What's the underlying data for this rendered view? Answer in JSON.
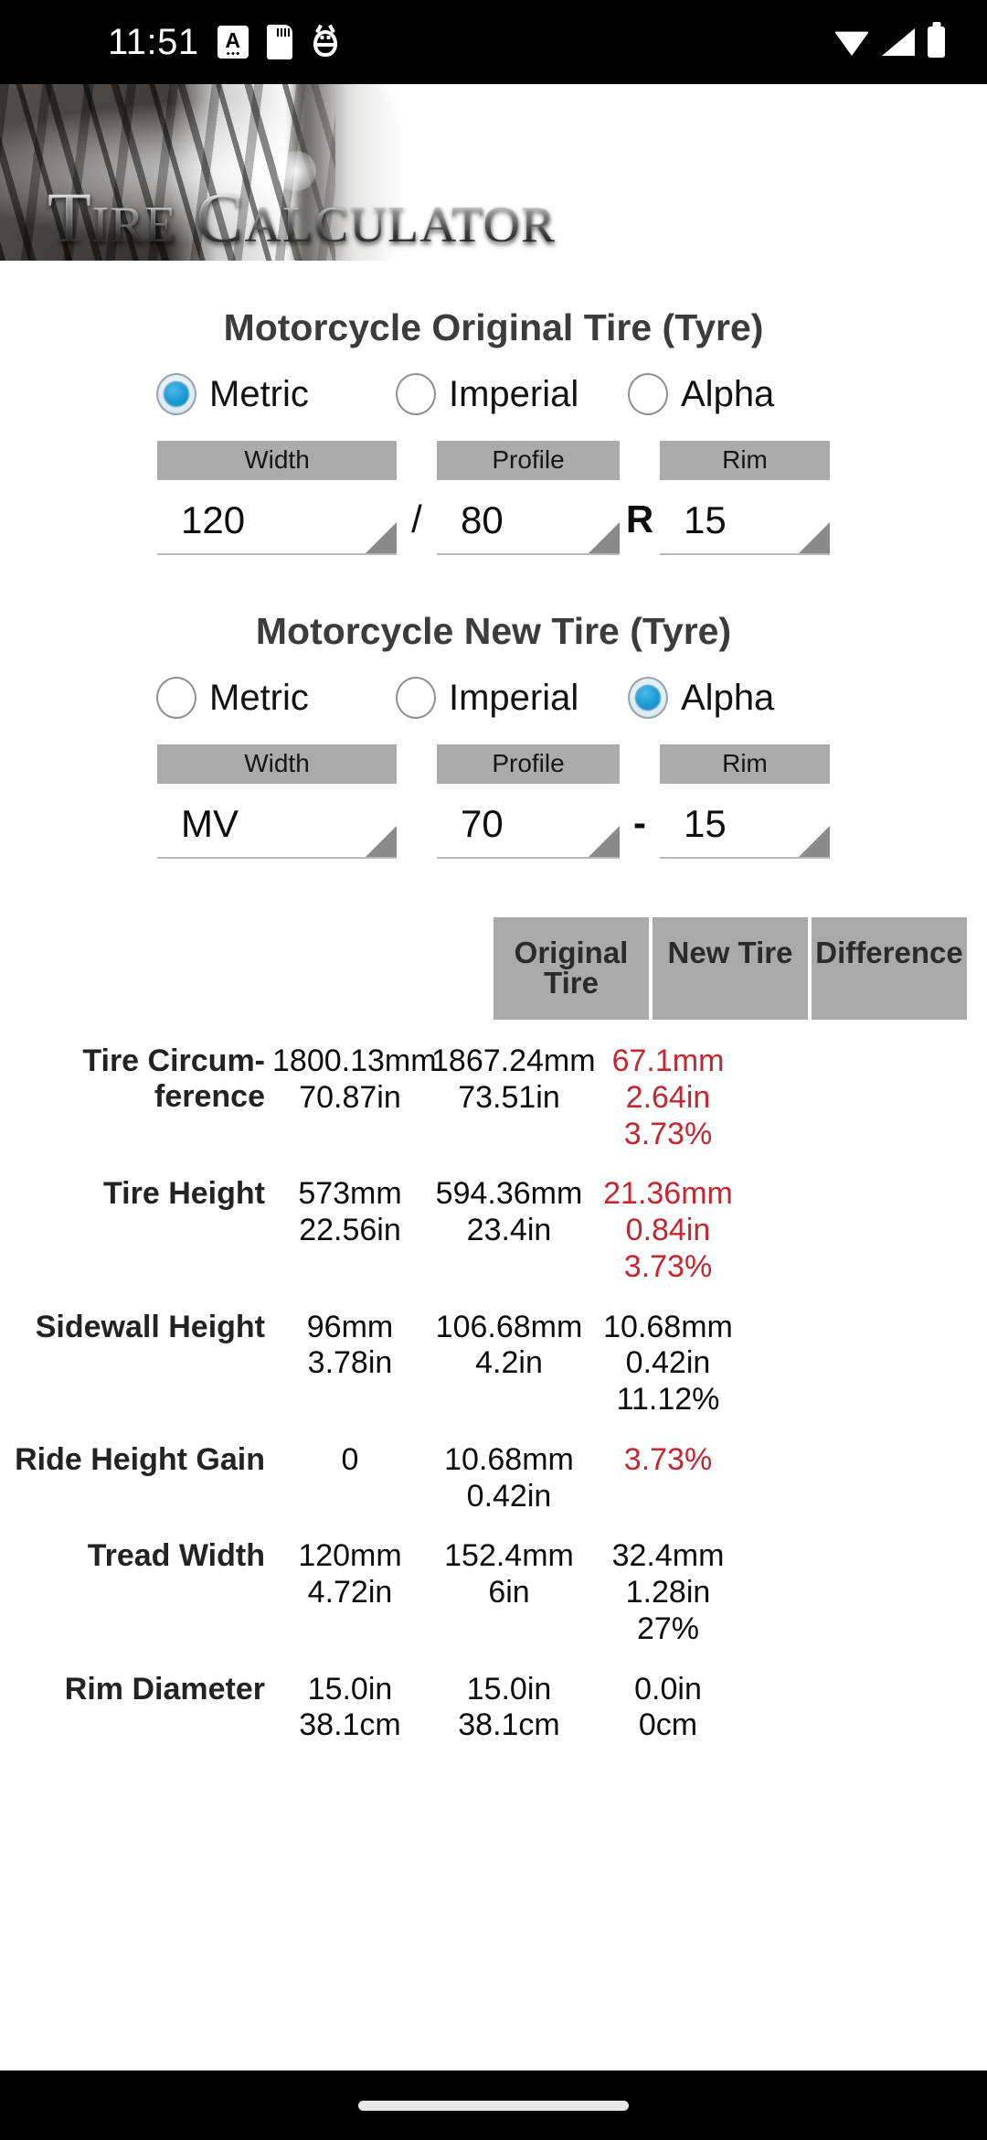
{
  "status_bar": {
    "time": "11:51",
    "icons_left": [
      "text-a-icon",
      "sdcard-icon",
      "bug-icon"
    ],
    "icons_right": [
      "wifi-icon",
      "cell-signal-icon",
      "battery-icon"
    ]
  },
  "banner": {
    "title_first": "T",
    "title_first_rest": "IRE",
    "title_second": "C",
    "title_second_rest": "ALCULATOR"
  },
  "original": {
    "heading": "Motorcycle Original Tire (Tyre)",
    "units": [
      {
        "label": "Metric",
        "selected": true
      },
      {
        "label": "Imperial",
        "selected": false
      },
      {
        "label": "Alpha",
        "selected": false
      }
    ],
    "fields": [
      {
        "head": "Width",
        "value": "120"
      },
      {
        "head": "Profile",
        "value": "80"
      },
      {
        "head": "Rim",
        "value": "15"
      }
    ],
    "sep1": "/",
    "sep2": "R"
  },
  "newtire": {
    "heading": "Motorcycle New Tire (Tyre)",
    "units": [
      {
        "label": "Metric",
        "selected": false
      },
      {
        "label": "Imperial",
        "selected": false
      },
      {
        "label": "Alpha",
        "selected": true
      }
    ],
    "fields": [
      {
        "head": "Width",
        "value": "MV"
      },
      {
        "head": "Profile",
        "value": "70"
      },
      {
        "head": "Rim",
        "value": "15"
      }
    ],
    "sep1": "",
    "sep2": "-"
  },
  "results": {
    "columns": [
      "Original Tire",
      "New Tire",
      "Difference"
    ],
    "accent_red": "#c32832",
    "rows": [
      {
        "label": "Tire Circum-ference",
        "original": [
          "1800.13mm",
          "70.87in"
        ],
        "new": [
          "1867.24mm",
          "73.51in"
        ],
        "difference": [
          "67.1mm",
          "2.64in",
          "3.73%"
        ],
        "difference_red": true
      },
      {
        "label": "Tire Height",
        "original": [
          "573mm",
          "22.56in"
        ],
        "new": [
          "594.36mm",
          "23.4in"
        ],
        "difference": [
          "21.36mm",
          "0.84in",
          "3.73%"
        ],
        "difference_red": true
      },
      {
        "label": "Sidewall Height",
        "original": [
          "96mm",
          "3.78in"
        ],
        "new": [
          "106.68mm",
          "4.2in"
        ],
        "difference": [
          "10.68mm",
          "0.42in",
          "11.12%"
        ],
        "difference_red": false
      },
      {
        "label": "Ride Height Gain",
        "original": [
          "0"
        ],
        "new": [
          "10.68mm",
          "0.42in"
        ],
        "difference": [
          "3.73%"
        ],
        "difference_red": true
      },
      {
        "label": "Tread Width",
        "original": [
          "120mm",
          "4.72in"
        ],
        "new": [
          "152.4mm",
          "6in"
        ],
        "difference": [
          "32.4mm",
          "1.28in",
          "27%"
        ],
        "difference_red": false
      },
      {
        "label": "Rim Diameter",
        "original": [
          "15.0in",
          "38.1cm"
        ],
        "new": [
          "15.0in",
          "38.1cm"
        ],
        "difference": [
          "0.0in",
          "0cm"
        ],
        "difference_red": false
      }
    ]
  }
}
